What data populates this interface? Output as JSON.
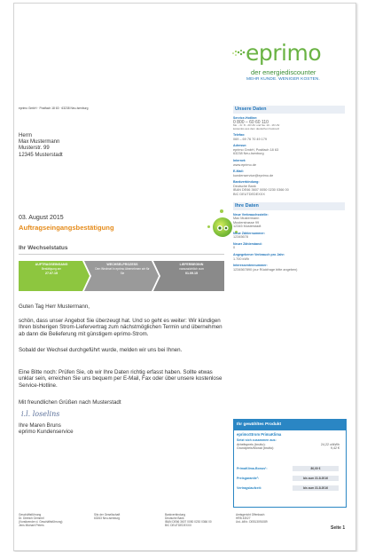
{
  "logo": {
    "word": "eprimo",
    "tagline": "der energiediscounter",
    "slogan": "MEHR KUNDE. WENIGER KOSTEN."
  },
  "sender_line": "eprimo GmbH · Postfach 18 63 · 63238 Neu-Isenburg",
  "recipient": [
    "Herrn",
    "Max Mustermann",
    "Musterstr. 99",
    "12345 Musterstadt"
  ],
  "date": "03. August 2015",
  "subject": "Auftragseingangsbestätigung",
  "status": {
    "title": "Ihr Wechselstatus",
    "steps": [
      {
        "title": "AUFTRAGSEINGANG",
        "sub": "Bestätigung am",
        "date": "27.07.15",
        "color": "#8dc63f"
      },
      {
        "title": "WECHSELPROZESS",
        "sub": "Den Wechsel in eprimo übernehmen wir für Sie",
        "date": "",
        "color": "#9a9a9a"
      },
      {
        "title": "LIEFERBEGINN",
        "sub": "voraussichtlich zum",
        "date": "01.09.15",
        "color": "#8a8a8a"
      }
    ]
  },
  "body": {
    "greeting": "Guten Tag Herr Mustermann,",
    "p1": "schön, dass unser Angebot Sie überzeugt hat. Und so geht es weiter: Wir kündigen Ihren bisherigen Strom-Liefervertrag zum nächstmöglichen Termin und übernehmen ab dann die Belieferung mit günstigem eprimo-Strom.",
    "p2": "Sobald der Wechsel durchgeführt wurde, melden wir uns bei Ihnen.",
    "p3": "Eine Bitte noch: Prüfen Sie, ob wir Ihre Daten richtig erfasst haben. Sollte etwas unklar sein, erreichen Sie uns bequem per E-Mail, Fax oder über unsere kostenlose Service-Hotline.",
    "closing": "Mit freundlichen Grüßen nach Musterstadt",
    "signature": "i.l. loselins",
    "signer": [
      "Ihre Maren Bruns",
      "eprimo Kundenservice"
    ]
  },
  "unsere_daten": {
    "heading": "Unsere Daten",
    "blocks": [
      {
        "label": "Service-Hotline:",
        "lines": [
          "0 800 – 60 60 110",
          "Mo. - Fr. 8 - 20 Uhr und Sa. 10 - 16 Uhr",
          "kostenlos aus dem deutschen Festnetz"
        ]
      },
      {
        "label": "Telefax:",
        "lines": [
          "069 – 69 76 70 49 179"
        ]
      },
      {
        "label": "Adresse:",
        "lines": [
          "eprimo GmbH, Postfach 18 63",
          "63238 Neu-Isenburg"
        ]
      },
      {
        "label": "Internet:",
        "lines": [
          "www.eprimo.de"
        ]
      },
      {
        "label": "E-Mail:",
        "lines": [
          "kundenservice@eprimo.de"
        ]
      },
      {
        "label": "Bankverbindung:",
        "lines": [
          "Deutsche Bank",
          "IBAN DE66 3607 0050 0230 0366 00",
          "BIC DEUTDEDEXXX"
        ]
      }
    ]
  },
  "ihre_daten": {
    "heading": "Ihre Daten",
    "blocks": [
      {
        "label": "Neue Verbrauchsstelle:",
        "lines": [
          "Max Mustermann",
          "Musterstrasse 99",
          "12345 Musterstadt"
        ]
      },
      {
        "label": "Neue Zählernummer:",
        "lines": [
          "12345678"
        ]
      },
      {
        "label": "Neuer Zählerstand:",
        "lines": [
          "0"
        ]
      },
      {
        "label": "Angegebener Verbrauch pro Jahr:",
        "lines": [
          "1.700 kWh"
        ]
      },
      {
        "label": "Interessentennummer:",
        "lines": [
          "1234567890 (zur Rückfrage bitte angeben)"
        ]
      }
    ]
  },
  "product": {
    "heading": "Ihr gewähltes Produkt",
    "name": "eprimoStrom PrimaKlima",
    "composition_label": "Setzt sich zusammen aus:",
    "arbeitspreis_label": "Arbeitspreis (brutto):",
    "arbeitspreis_value": "24,22 ct/kWh",
    "grundpreis_label": "Grundpreis/Monat (brutto):",
    "grundpreis_value": "9,42 €",
    "bonus_label": "PrimaKlima-Bonus¹:",
    "bonus_value": "80,00 €",
    "garantie_label": "Preisgarantie²:",
    "garantie_value": "bis zum 31.8.2016",
    "laufzeit_label": "Vertragslaufzeit:",
    "laufzeit_value": "bis zum 31.8.2016"
  },
  "footer": [
    [
      "Geschäftsführung",
      "Dr. Dietrich Gemmel",
      "(Vorsitzender d. Geschäftsführung)",
      "Jens Michael Peters"
    ],
    [
      "Sitz der Gesellschaft",
      "63263 Neu-Isenburg"
    ],
    [
      "Bankverbindung",
      "Deutsche Bank",
      "IBAN DE66 3607 0050 0230 0366 00",
      "BIC DEUTDEDEXXX"
    ],
    [
      "Amtsgericht Offenbach",
      "HRB 43027",
      "Ust.-IdNr.: DE813091089"
    ]
  ],
  "page_number": "Seite 1"
}
